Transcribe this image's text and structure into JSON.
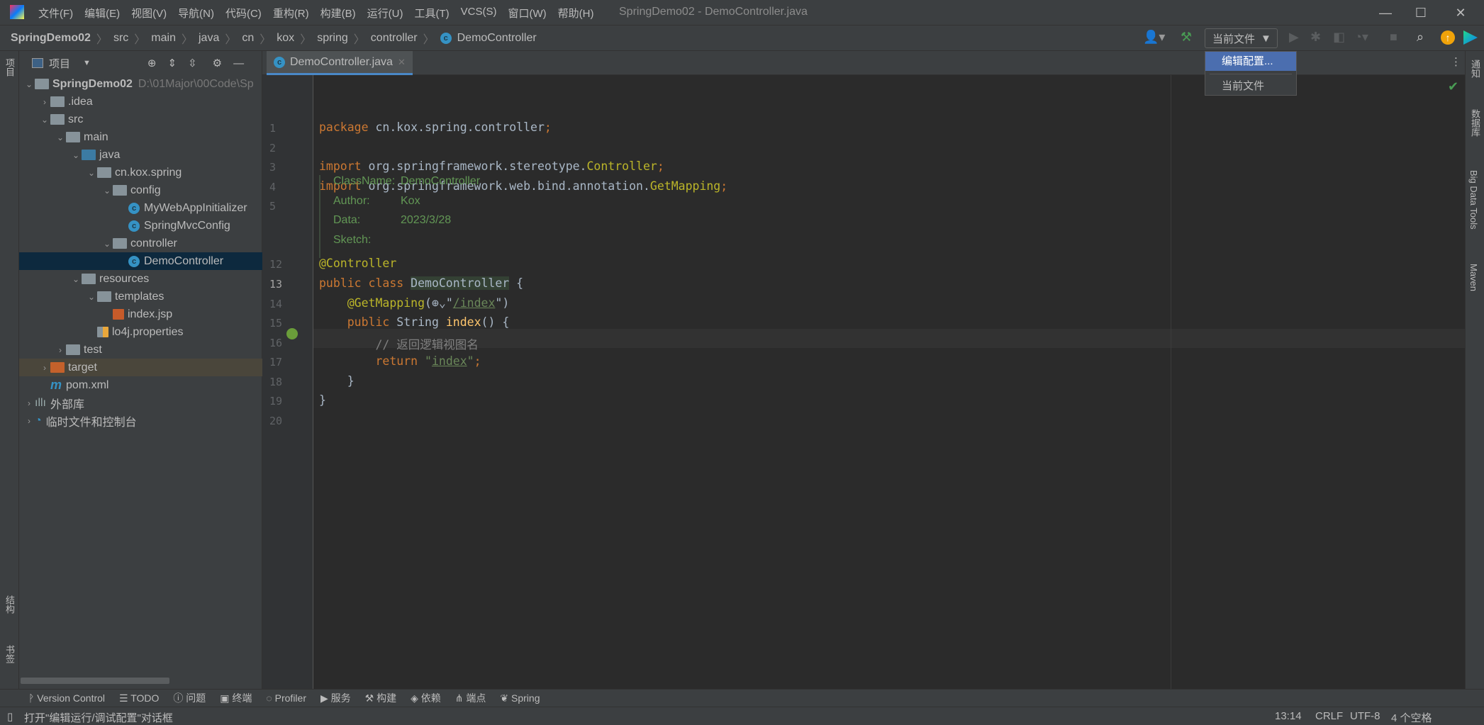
{
  "window": {
    "title": "SpringDemo02 - DemoController.java",
    "minimize": "—",
    "maximize": "☐",
    "close": "✕"
  },
  "menu": [
    "文件(F)",
    "编辑(E)",
    "视图(V)",
    "导航(N)",
    "代码(C)",
    "重构(R)",
    "构建(B)",
    "运行(U)",
    "工具(T)",
    "VCS(S)",
    "窗口(W)",
    "帮助(H)"
  ],
  "breadcrumb": [
    "SpringDemo02",
    "src",
    "main",
    "java",
    "cn",
    "kox",
    "spring",
    "controller",
    "DemoController"
  ],
  "toolbar": {
    "run_config": "当前文件",
    "dropdown": [
      "编辑配置...",
      "当前文件"
    ]
  },
  "project": {
    "title": "项目",
    "tree": [
      {
        "label": "SpringDemo02",
        "hint": "D:\\01Major\\00Code\\Sp",
        "depth": 0,
        "arrow": "v",
        "icon": "module"
      },
      {
        "label": ".idea",
        "depth": 1,
        "arrow": ">",
        "icon": "folder"
      },
      {
        "label": "src",
        "depth": 1,
        "arrow": "v",
        "icon": "folder"
      },
      {
        "label": "main",
        "depth": 2,
        "arrow": "v",
        "icon": "folder"
      },
      {
        "label": "java",
        "depth": 3,
        "arrow": "v",
        "icon": "src"
      },
      {
        "label": "cn.kox.spring",
        "depth": 4,
        "arrow": "v",
        "icon": "package"
      },
      {
        "label": "config",
        "depth": 5,
        "arrow": "v",
        "icon": "package"
      },
      {
        "label": "MyWebAppInitializer",
        "depth": 6,
        "arrow": "",
        "icon": "class"
      },
      {
        "label": "SpringMvcConfig",
        "depth": 6,
        "arrow": "",
        "icon": "class"
      },
      {
        "label": "controller",
        "depth": 5,
        "arrow": "v",
        "icon": "package"
      },
      {
        "label": "DemoController",
        "depth": 6,
        "arrow": "",
        "icon": "class",
        "selected": true
      },
      {
        "label": "resources",
        "depth": 3,
        "arrow": "v",
        "icon": "folder"
      },
      {
        "label": "templates",
        "depth": 4,
        "arrow": "v",
        "icon": "folder"
      },
      {
        "label": "index.jsp",
        "depth": 5,
        "arrow": "",
        "icon": "jsp"
      },
      {
        "label": "lo4j.properties",
        "depth": 4,
        "arrow": "",
        "icon": "properties"
      },
      {
        "label": "test",
        "depth": 2,
        "arrow": ">",
        "icon": "folder"
      },
      {
        "label": "target",
        "depth": 1,
        "arrow": ">",
        "icon": "excluded",
        "excluded": true
      },
      {
        "label": "pom.xml",
        "depth": 1,
        "arrow": "",
        "icon": "maven"
      },
      {
        "label": "外部库",
        "depth": 0,
        "arrow": ">",
        "icon": "library"
      },
      {
        "label": "临时文件和控制台",
        "depth": 0,
        "arrow": ">",
        "icon": "scratch"
      }
    ]
  },
  "left_strip": [
    "项目",
    "结构",
    "书签"
  ],
  "editor": {
    "tab": "DemoController.java",
    "lines": [
      {
        "n": "1",
        "t": [
          [
            "kw",
            "package "
          ],
          [
            "",
            "cn.kox.spring.controller"
          ],
          [
            "kw",
            ";"
          ]
        ]
      },
      {
        "n": "2",
        "t": []
      },
      {
        "n": "3",
        "t": [
          [
            "kw",
            "import "
          ],
          [
            "",
            "org.springframework.stereotype."
          ],
          [
            "an",
            "Controller"
          ],
          [
            "kw",
            ";"
          ]
        ]
      },
      {
        "n": "4",
        "t": [
          [
            "kw",
            "import "
          ],
          [
            "",
            "org.springframework.web.bind.annotation."
          ],
          [
            "an",
            "GetMapping"
          ],
          [
            "kw",
            ";"
          ]
        ]
      },
      {
        "n": "5",
        "t": []
      },
      {
        "n": "12",
        "t": [
          [
            "an",
            "@Controller"
          ]
        ]
      },
      {
        "n": "13",
        "t": [
          [
            "kw",
            "public class "
          ],
          [
            "cls",
            "DemoController"
          ],
          [
            "",
            " {"
          ]
        ]
      },
      {
        "n": "14",
        "t": [
          [
            "",
            "    "
          ],
          [
            "an",
            "@GetMapping"
          ],
          [
            "",
            "(⊕⌄\""
          ],
          [
            "str u",
            "/index"
          ],
          [
            "",
            "\")"
          ]
        ]
      },
      {
        "n": "15",
        "t": [
          [
            "",
            "    "
          ],
          [
            "kw",
            "public "
          ],
          [
            "",
            "String "
          ],
          [
            "fn",
            "index"
          ],
          [
            "",
            "() {"
          ]
        ]
      },
      {
        "n": "16",
        "t": [
          [
            "",
            "        "
          ],
          [
            "cm",
            "// 返回逻辑视图名"
          ]
        ]
      },
      {
        "n": "17",
        "t": [
          [
            "",
            "        "
          ],
          [
            "kw",
            "return "
          ],
          [
            "str",
            "\""
          ],
          [
            "str u",
            "index"
          ],
          [
            "str",
            "\""
          ],
          [
            "kw",
            ";"
          ]
        ]
      },
      {
        "n": "18",
        "t": [
          [
            "",
            "    }"
          ]
        ]
      },
      {
        "n": "19",
        "t": [
          [
            "",
            "}"
          ]
        ]
      },
      {
        "n": "20",
        "t": []
      }
    ],
    "doc": [
      [
        "ClassName:",
        "DemoController"
      ],
      [
        "Author:",
        "Kox"
      ],
      [
        "Data:",
        "2023/3/28"
      ],
      [
        "Sketch:",
        ""
      ]
    ]
  },
  "right_strip": [
    "通知",
    "数据库",
    "Big Data Tools",
    "Maven"
  ],
  "bottom_tools": [
    "Version Control",
    "TODO",
    "问题",
    "终端",
    "Profiler",
    "服务",
    "构建",
    "依赖",
    "端点",
    "Spring"
  ],
  "status": {
    "message": "打开\"编辑运行/调试配置\"对话框",
    "position": "13:14",
    "line_ending": "CRLF",
    "encoding": "UTF-8",
    "indent": "4 个空格"
  }
}
